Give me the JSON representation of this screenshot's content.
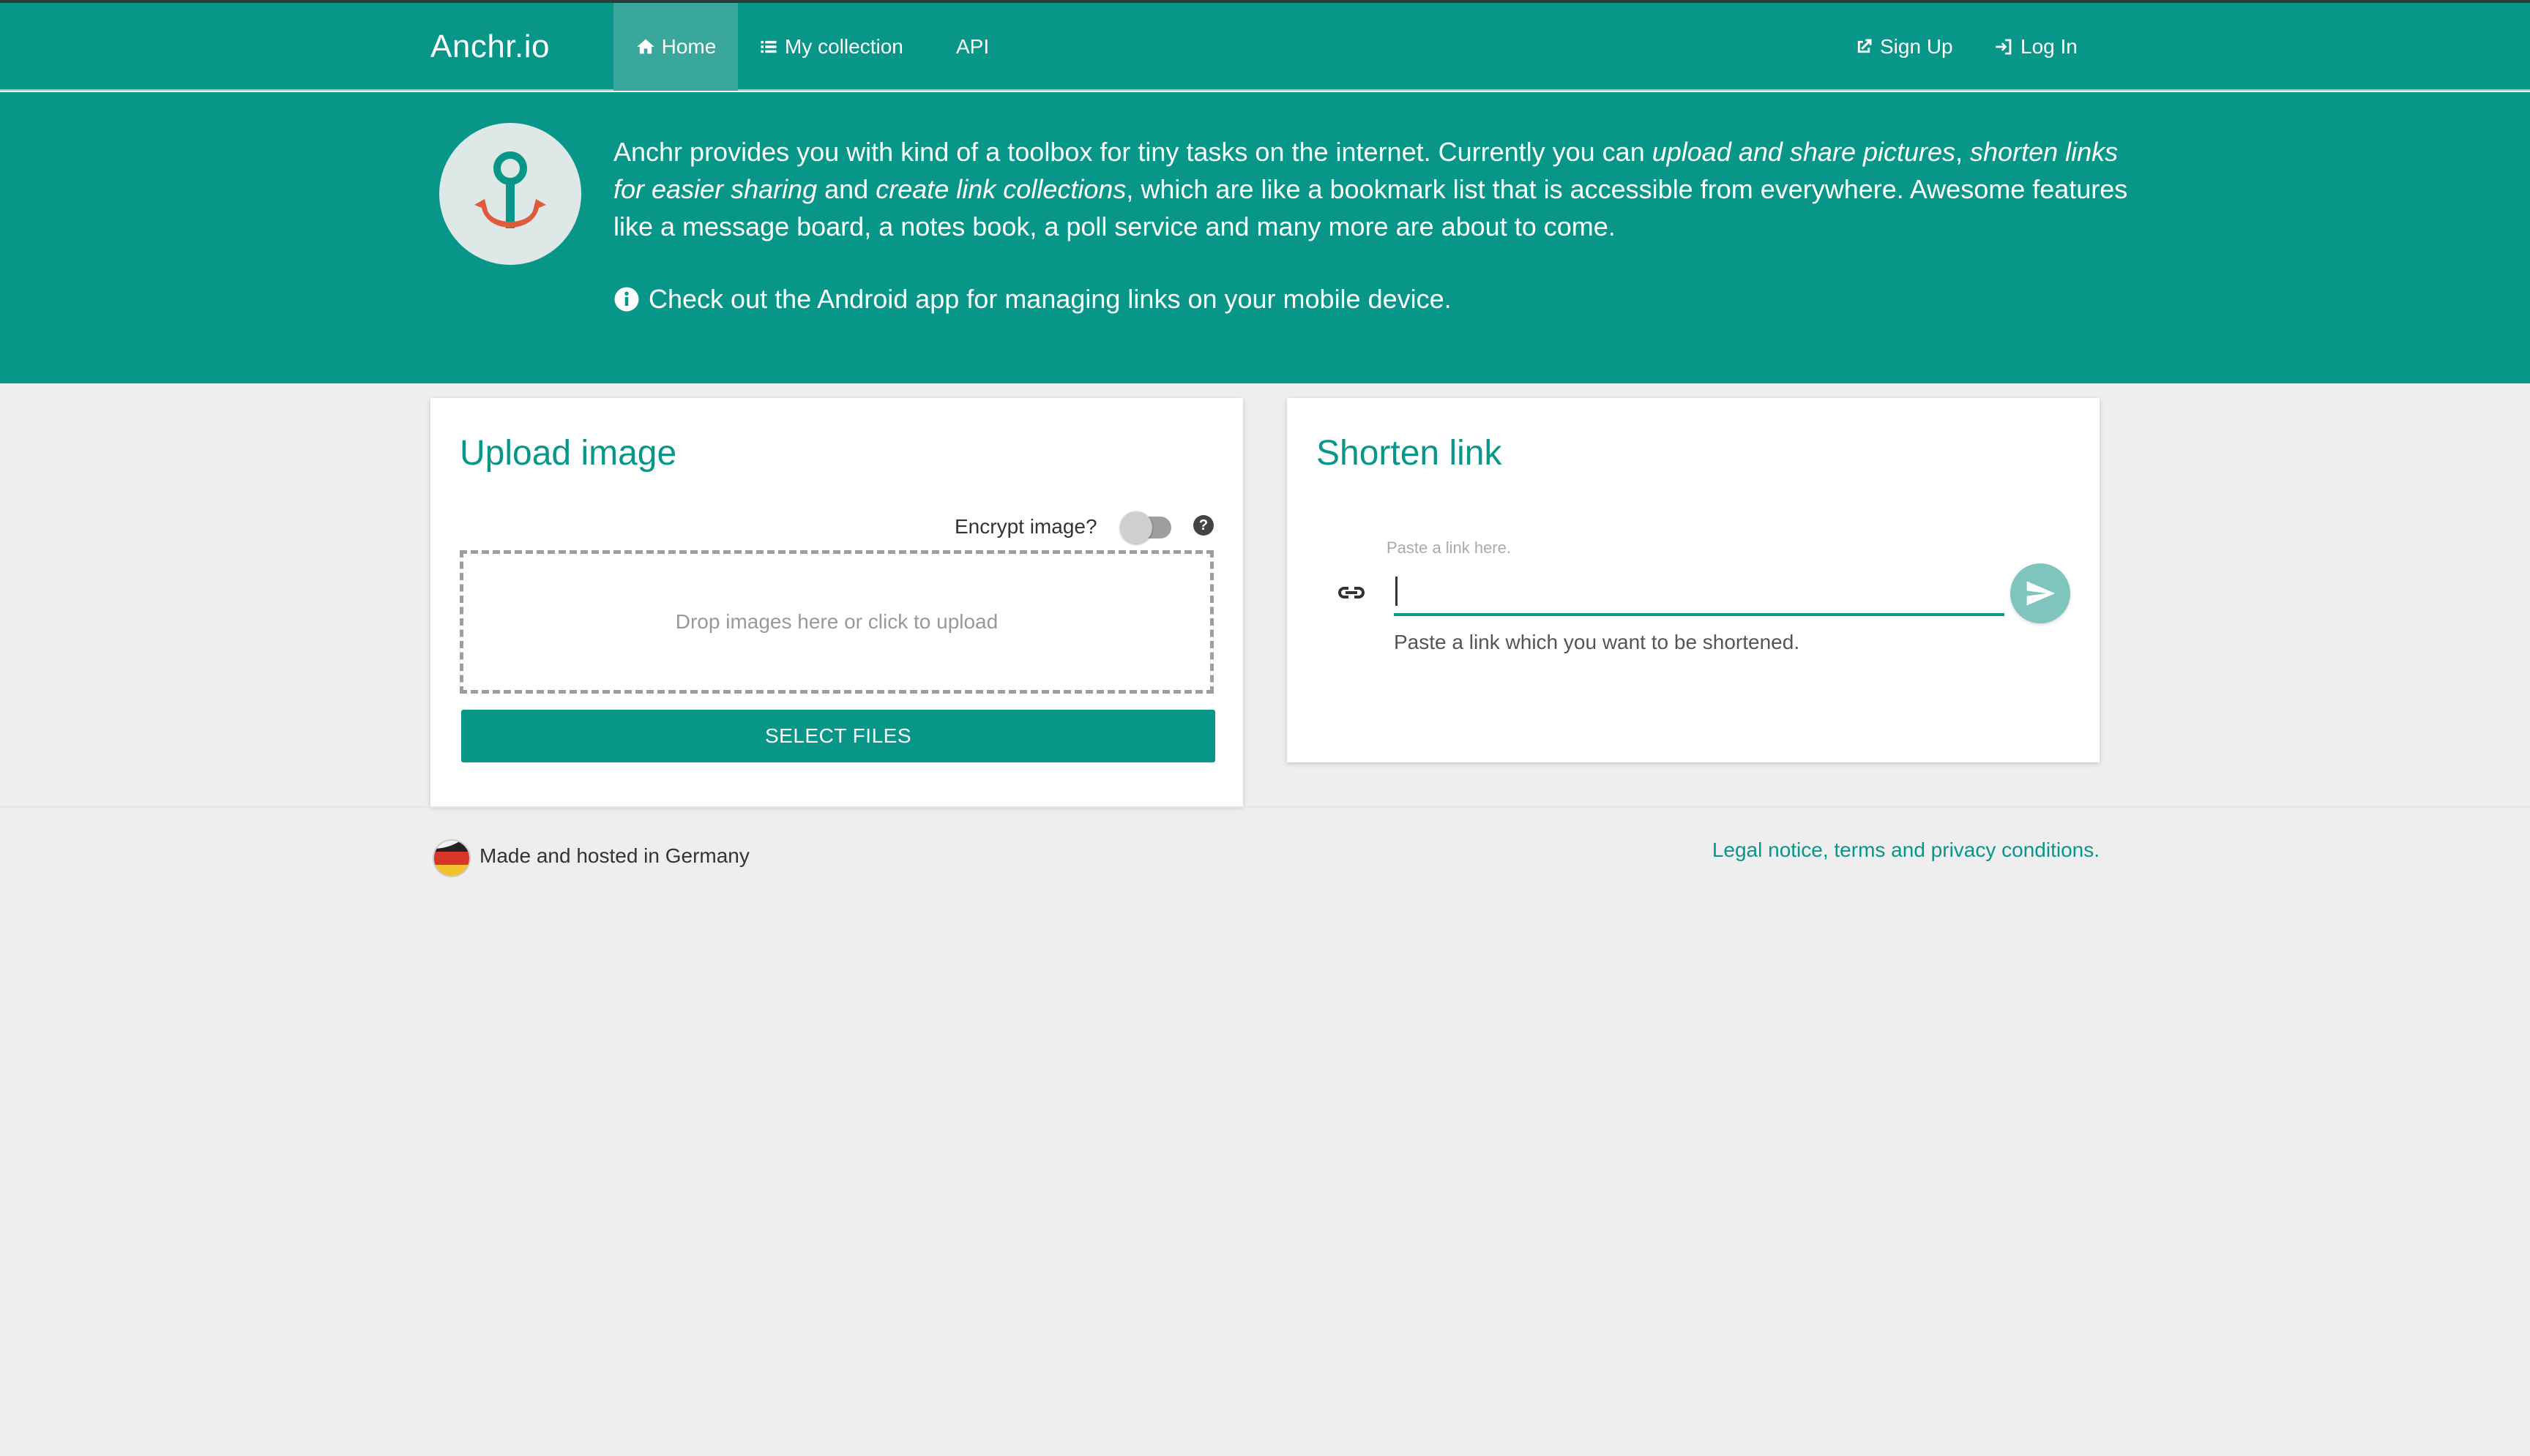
{
  "navbar": {
    "brand": "Anchr.io",
    "items": [
      {
        "label": "Home",
        "icon": "home-icon",
        "active": true
      },
      {
        "label": "My collection",
        "icon": "list-icon"
      },
      {
        "label": "API"
      }
    ],
    "right_items": [
      {
        "label": "Sign Up",
        "icon": "external-link-icon"
      },
      {
        "label": "Log In",
        "icon": "login-icon"
      }
    ]
  },
  "hero": {
    "text_parts": [
      "Anchr provides you with kind of a toolbox for tiny tasks on the internet. Currently you can ",
      "upload and share pictures",
      ", ",
      "shorten links for easier sharing",
      " and ",
      "create link collections",
      ", which are like a bookmark list that is accessible from everywhere. Awesome features like a message board, a notes book, a poll service and many more are about to come."
    ],
    "note": "Check out the Android app for managing links on your mobile device."
  },
  "upload": {
    "title": "Upload image",
    "encrypt_label": "Encrypt image?",
    "dropzone_text": "Drop images here or click to upload",
    "select_button": "SELECT FILES"
  },
  "shorten": {
    "title": "Shorten link",
    "input_hint": "Paste a link here.",
    "input_value": "",
    "helper_text": "Paste a link which you want to be shortened."
  },
  "footer": {
    "left": "Made and hosted in Germany",
    "right": "Legal notice, terms and privacy conditions."
  },
  "colors": {
    "primary": "#089688",
    "active_nav": "#3aa79c",
    "background": "#eeeeee",
    "anchor": "#e05a3c"
  }
}
